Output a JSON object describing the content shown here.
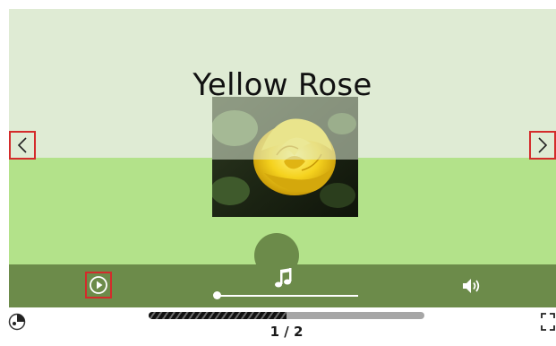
{
  "slide": {
    "title": "Yellow Rose",
    "photo": "yellow-rose-photo"
  },
  "navigation": {
    "prev_icon": "chevron-left-icon",
    "next_icon": "chevron-right-icon"
  },
  "controls": {
    "play_icon": "play-icon",
    "music_icon": "music-note-icon",
    "music_position": 0.04,
    "volume_icon": "volume-icon"
  },
  "footer": {
    "logo_icon": "globe-logo-icon",
    "progress_fraction": 0.5,
    "page_counter": "1 / 2",
    "fullscreen_icon": "fullscreen-icon"
  },
  "colors": {
    "stage_light": "#dfebd4",
    "stage_green": "#b3e28a",
    "control_bar": "#6c8b4a",
    "highlight_border": "#d42b2b"
  }
}
